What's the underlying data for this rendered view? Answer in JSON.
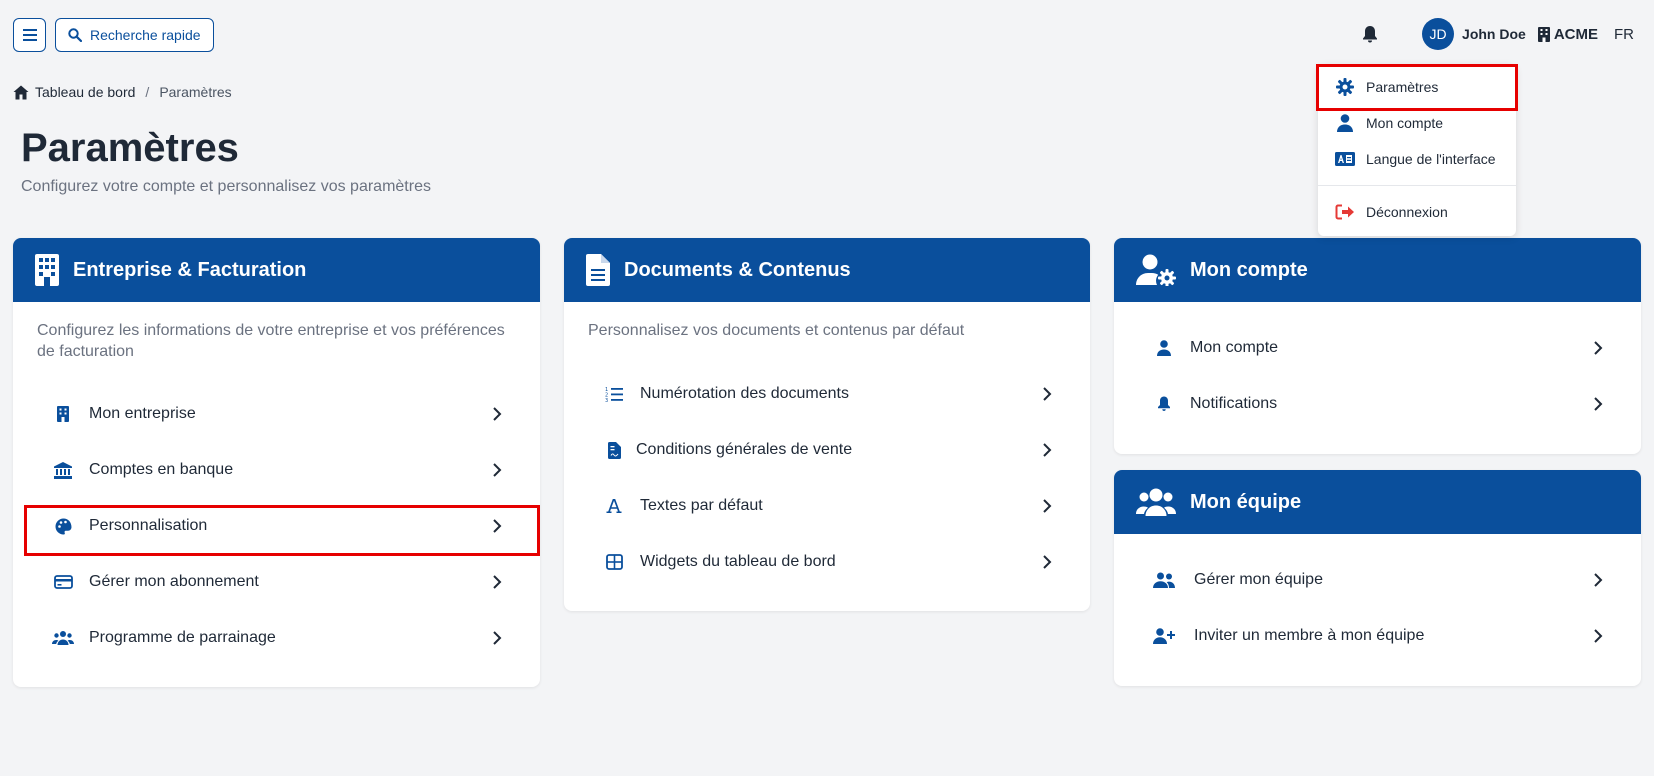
{
  "topbar": {
    "search_label": "Recherche rapide",
    "user_initials": "JD",
    "user_name": "John Doe",
    "company": "ACME",
    "language": "FR"
  },
  "breadcrumb": {
    "home": "Tableau de bord",
    "separator": "/",
    "current": "Paramètres"
  },
  "page": {
    "title": "Paramètres",
    "subtitle": "Configurez votre compte et personnalisez vos paramètres"
  },
  "user_menu": {
    "items": [
      {
        "label": "Paramètres",
        "icon": "gear-icon"
      },
      {
        "label": "Mon compte",
        "icon": "user-icon"
      },
      {
        "label": "Langue de l'interface",
        "icon": "language-icon"
      },
      {
        "label": "Déconnexion",
        "icon": "logout-icon",
        "color": "#e53935"
      }
    ]
  },
  "cards": {
    "billing": {
      "title": "Entreprise & Facturation",
      "description": "Configurez les informations de votre entreprise et vos préférences de facturation",
      "items": [
        {
          "label": "Mon entreprise",
          "icon": "building-icon"
        },
        {
          "label": "Comptes en banque",
          "icon": "bank-icon"
        },
        {
          "label": "Personnalisation",
          "icon": "palette-icon"
        },
        {
          "label": "Gérer mon abonnement",
          "icon": "credit-card-icon"
        },
        {
          "label": "Programme de parrainage",
          "icon": "users-icon"
        }
      ]
    },
    "documents": {
      "title": "Documents & Contenus",
      "description": "Personnalisez vos documents et contenus par défaut",
      "items": [
        {
          "label": "Numérotation des documents",
          "icon": "numbered-list-icon"
        },
        {
          "label": "Conditions générales de vente",
          "icon": "document-icon"
        },
        {
          "label": "Textes par défaut",
          "icon": "font-icon"
        },
        {
          "label": "Widgets du tableau de bord",
          "icon": "table-icon"
        }
      ]
    },
    "account": {
      "title": "Mon compte",
      "items": [
        {
          "label": "Mon compte",
          "icon": "user-icon"
        },
        {
          "label": "Notifications",
          "icon": "bell-icon"
        }
      ]
    },
    "team": {
      "title": "Mon équipe",
      "items": [
        {
          "label": "Gérer mon équipe",
          "icon": "users-icon"
        },
        {
          "label": "Inviter un membre à mon équipe",
          "icon": "user-plus-icon"
        }
      ]
    }
  },
  "colors": {
    "primary": "#0a4f9c",
    "highlight": "#e60000",
    "background": "#f3f4f6"
  }
}
